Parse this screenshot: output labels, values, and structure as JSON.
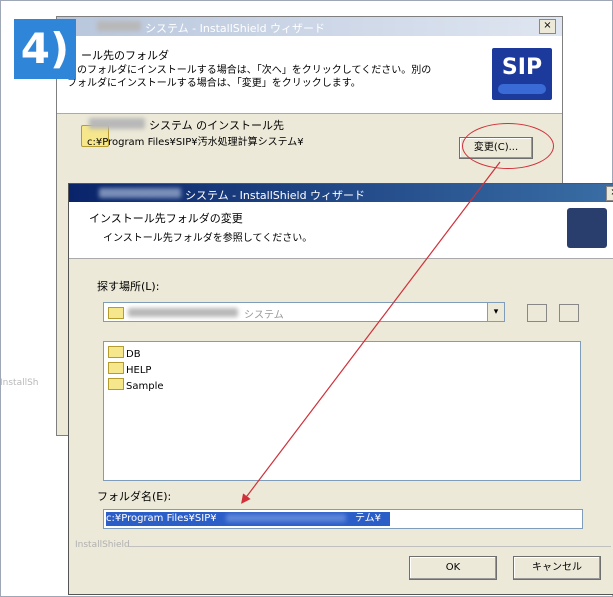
{
  "step": "4)",
  "back_window": {
    "title": "システム - InstallShield ウィザード",
    "close": "×",
    "header_title": "ール先のフォルダ",
    "header_desc_1": "このフォルダにインストールする場合は、「次へ」をクリックしてください。別の",
    "header_desc_2": "フォルダにインストールする場合は、「変更」をクリックします。",
    "logo_text": "SIP",
    "install_label": "システム のインストール先",
    "install_path": "c:¥Program Files¥SIP¥汚水処理計算システム¥",
    "change_button": "変更(C)...",
    "left_label": "InstallSh"
  },
  "dialog": {
    "title": "システム - InstallShield ウィザード",
    "close": "×",
    "header_title": "インストール先フォルダの変更",
    "header_desc": "インストール先フォルダを参照してください。",
    "look_in_label": "探す場所(L):",
    "look_in_value": "システム",
    "folders": [
      "DB",
      "HELP",
      "Sample"
    ],
    "folder_name_label": "フォルダ名(E):",
    "folder_name_value": "c:¥Program Files¥SIP¥",
    "folder_name_tail": "テム¥",
    "brand": "InstallShield",
    "ok_button": "OK",
    "cancel_button": "キャンセル"
  },
  "colors": {
    "step_badge": "#2f86d8",
    "annotation": "#d0303a",
    "title_bar": "#0a246a"
  }
}
